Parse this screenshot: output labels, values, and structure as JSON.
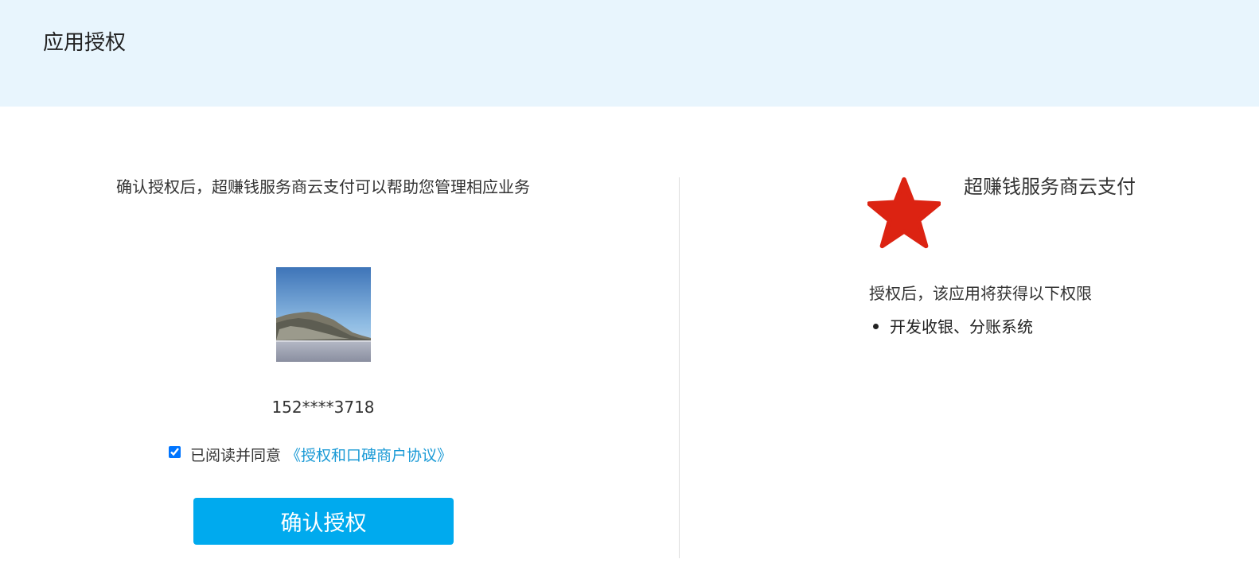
{
  "header": {
    "title": "应用授权"
  },
  "left": {
    "intro": "确认授权后，超赚钱服务商云支付可以帮助您管理相应业务",
    "phone": "152****3718",
    "agreement": {
      "checked": true,
      "prefix": "已阅读并同意",
      "link_label": "《授权和口碑商户协议》"
    },
    "confirm_label": "确认授权"
  },
  "right": {
    "app_name": "超赚钱服务商云支付",
    "logo_icon": "red-star-icon",
    "permissions_title": "授权后，该应用将获得以下权限",
    "permissions": [
      {
        "label": "开发收银、分账系统"
      }
    ]
  },
  "colors": {
    "header_bg": "#e8f5fd",
    "link": "#1a9ad6",
    "button": "#00aaee",
    "star": "#dc2312"
  }
}
